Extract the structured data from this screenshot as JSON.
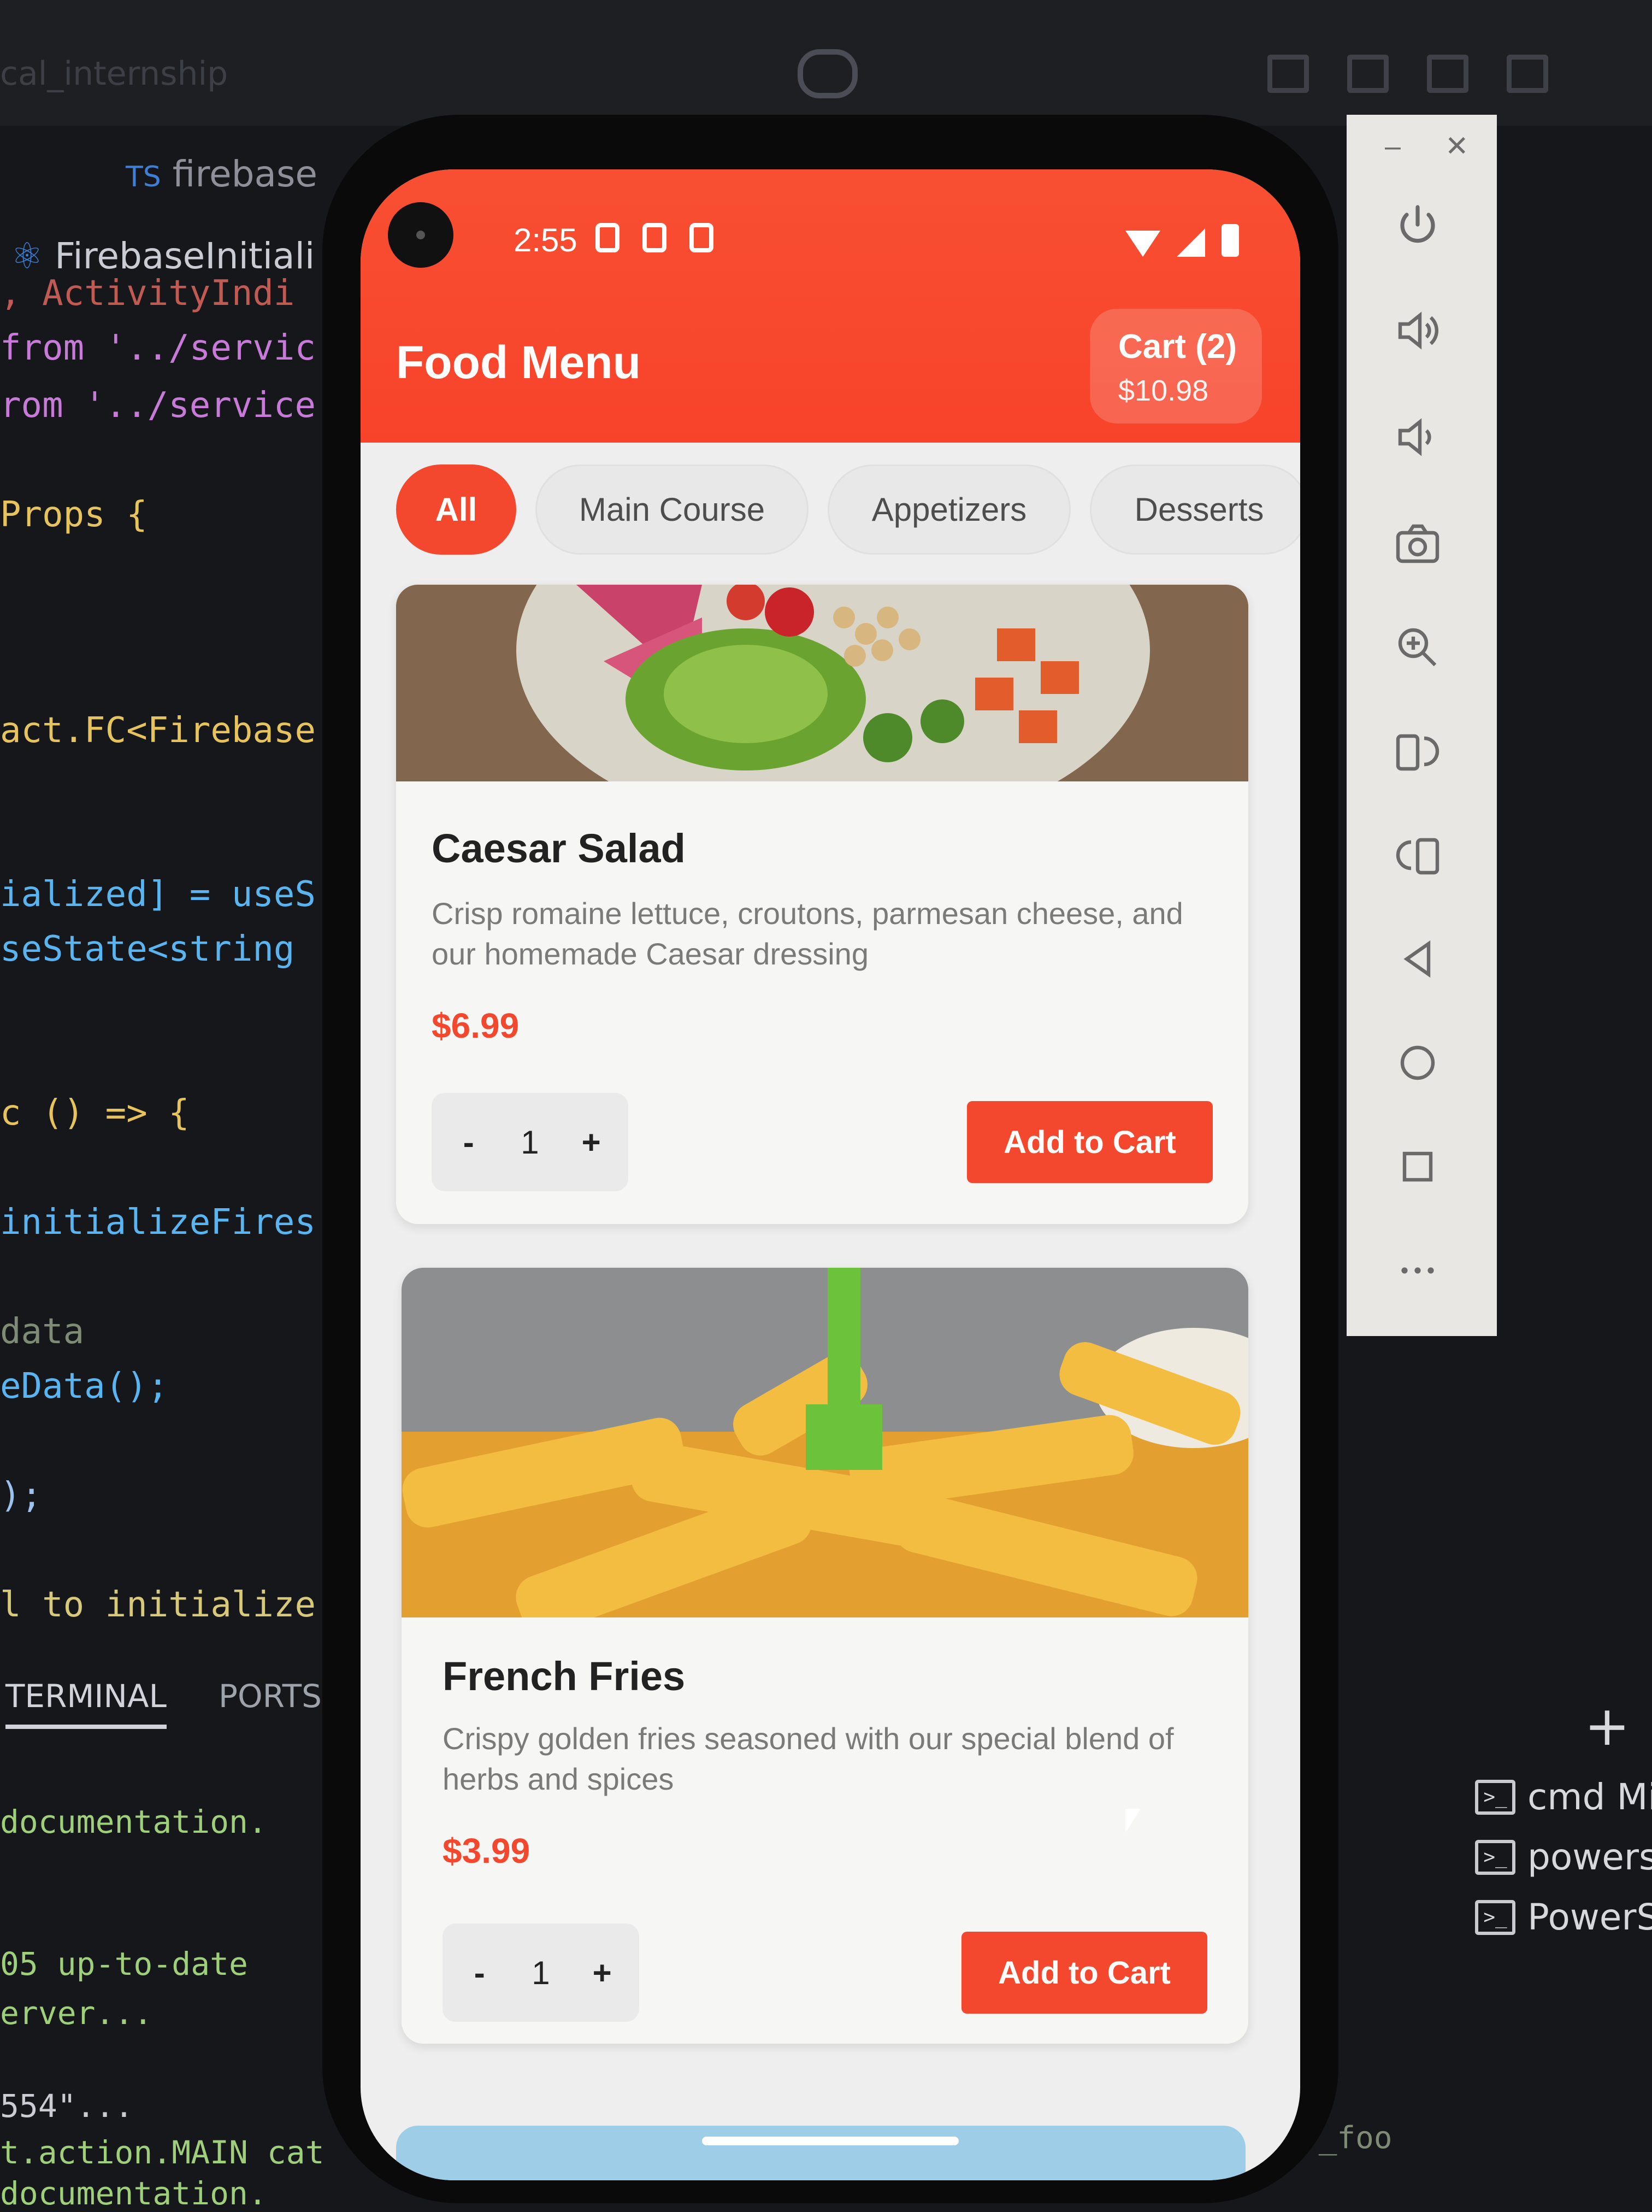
{
  "ide": {
    "window_title": "cal_internship",
    "tabs": [
      {
        "prefix": "TS",
        "label": "firebase"
      },
      {
        "prefix": "",
        "label": "FirebaseInitiali"
      }
    ],
    "code_lines": [
      ", ActivityIndi",
      "from '../servic",
      "rom '../service",
      "Props {",
      "act.FC<Firebase",
      "ialized] = useS",
      "seState<string",
      "c () => {",
      "initializeFires",
      "data",
      "eData();",
      ");",
      "l to initialize"
    ],
    "terminal_tabs": [
      "TERMINAL",
      "PORTS"
    ],
    "terminal_lines": [
      "documentation.",
      "05 up-to-date",
      "erver...",
      "554\"...",
      "t.action.MAIN cat",
      "documentation."
    ],
    "shells": [
      "cmd Mi",
      "powersh",
      "PowerSh"
    ],
    "footer_text": "._foo"
  },
  "emulator": {
    "toolbar": {
      "minimize_label": "–",
      "close_label": "✕",
      "tools": [
        "power",
        "volume-up",
        "volume-down",
        "screenshot",
        "zoom",
        "rotate-right",
        "rotate-left",
        "back",
        "home",
        "overview",
        "more"
      ]
    }
  },
  "status_bar": {
    "time": "2:55"
  },
  "app": {
    "title": "Food Menu",
    "cart": {
      "label": "Cart (2)",
      "total": "$10.98"
    },
    "categories": [
      {
        "label": "All",
        "active": true
      },
      {
        "label": "Main Course",
        "active": false
      },
      {
        "label": "Appetizers",
        "active": false
      },
      {
        "label": "Desserts",
        "active": false
      }
    ],
    "items": [
      {
        "name": "Caesar Salad",
        "description": "Crisp romaine lettuce, croutons, parmesan cheese, and our homemade Caesar dressing",
        "price": "$6.99",
        "quantity": "1",
        "minus_label": "-",
        "plus_label": "+",
        "add_label": "Add to Cart"
      },
      {
        "name": "French Fries",
        "description": "Crispy golden fries seasoned with our special blend of herbs and spices",
        "price": "$3.99",
        "quantity": "1",
        "minus_label": "-",
        "plus_label": "+",
        "add_label": "Add to Cart"
      }
    ]
  },
  "colors": {
    "accent": "#f4482e",
    "background": "#eeeeee"
  }
}
